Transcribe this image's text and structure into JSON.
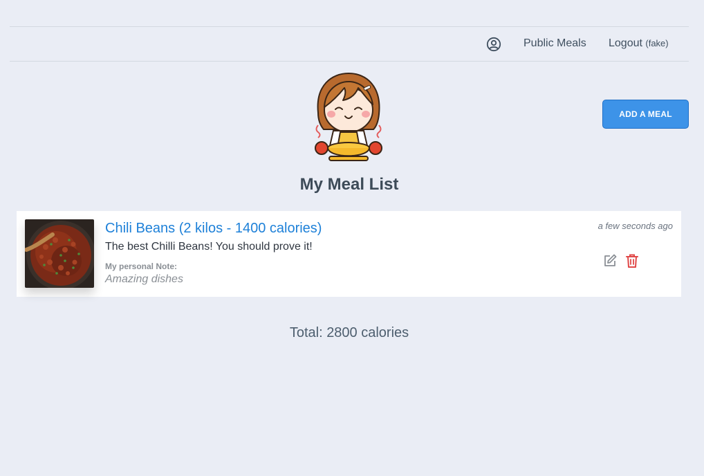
{
  "nav": {
    "user_icon": "user-circle-icon",
    "public_meals": "Public Meals",
    "logout": "Logout",
    "logout_note": "(fake)"
  },
  "header": {
    "mascot": "chef-girl-holding-pot-illustration",
    "add_button": "ADD A MEAL",
    "title": "My Meal List"
  },
  "meals": [
    {
      "image": "chili-beans-photo",
      "title": "Chili Beans (2 kilos - 1400 calories)",
      "description": "The best Chilli Beans! You should prove it!",
      "note_label": "My personal Note:",
      "note": "Amazing dishes",
      "timestamp": "a few seconds ago",
      "edit_icon": "edit-icon",
      "delete_icon": "trash-icon"
    }
  ],
  "total": "Total: 2800 calories",
  "colors": {
    "background": "#eaedf5",
    "accent": "#3d93e8",
    "link": "#1d80d8",
    "danger": "#e04848"
  }
}
